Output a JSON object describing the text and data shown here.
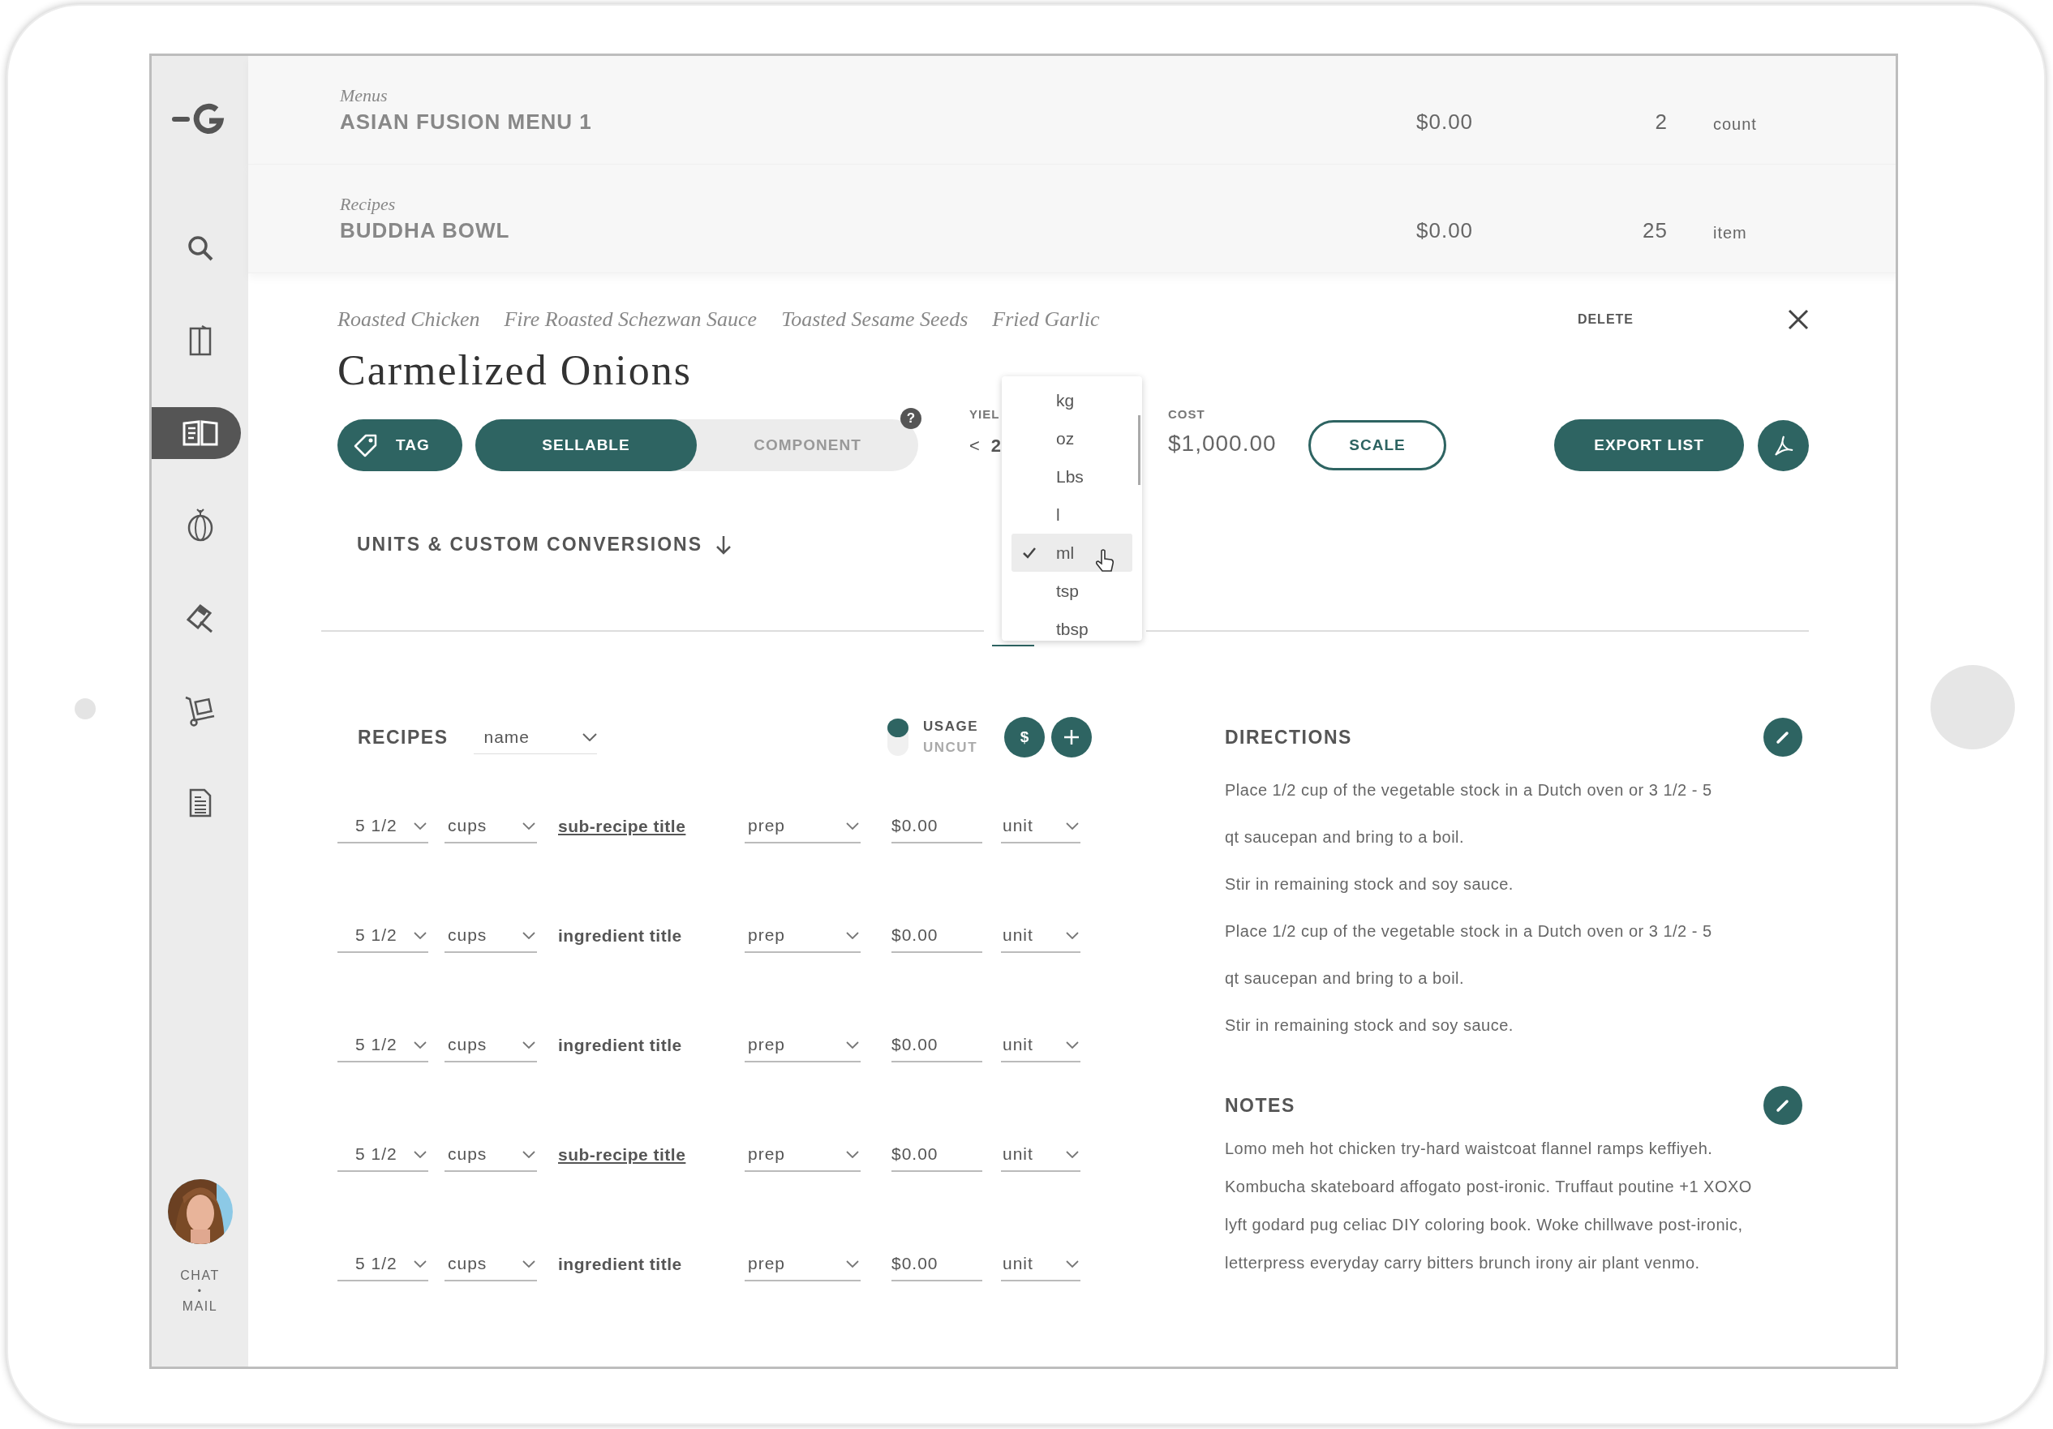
{
  "sidebar": {
    "items": [
      {
        "kind": "search",
        "selected": false
      },
      {
        "kind": "menu",
        "selected": false
      },
      {
        "kind": "recipes",
        "selected": true
      },
      {
        "kind": "produce",
        "selected": false
      },
      {
        "kind": "tag",
        "selected": false
      },
      {
        "kind": "cart",
        "selected": false
      },
      {
        "kind": "report",
        "selected": false
      }
    ],
    "user": {
      "kind": "picture"
    },
    "links": [
      "CHAT",
      "•",
      "MAIL"
    ]
  },
  "header_rows": [
    {
      "category": "Menus",
      "title": "ASIAN FUSION MENU 1",
      "price": "$0.00",
      "quantity": "2",
      "unit": "count"
    },
    {
      "category": "Recipes",
      "title": "BUDDHA BOWL",
      "price": "$0.00",
      "quantity": "25",
      "unit": "item"
    }
  ],
  "breadcrumbs": [
    "Roasted Chicken",
    "Fire Roasted Schezwan Sauce",
    "Toasted Sesame Seeds",
    "Fried Garlic"
  ],
  "delete": "DELETE",
  "title": "Carmelized Onions",
  "tag_button": "TAG",
  "type_toggle": [
    {
      "label": "SELLABLE",
      "selected": true
    },
    {
      "label": "COMPONENT",
      "selected": false
    }
  ],
  "help": "?",
  "yield": {
    "label": "YIEL",
    "prev": "<",
    "value": "2"
  },
  "cost": {
    "label": "COST",
    "value": "$1,000.00"
  },
  "scale_button": "SCALE",
  "export_button": "EXPORT LIST",
  "unit_dropdown": {
    "options": [
      {
        "label": "kg",
        "selected": false
      },
      {
        "label": "oz",
        "selected": false
      },
      {
        "label": "Lbs",
        "selected": false
      },
      {
        "label": "l",
        "selected": false
      },
      {
        "label": "ml",
        "selected": true
      },
      {
        "label": "tsp",
        "selected": false
      },
      {
        "label": "tbsp",
        "selected": false
      }
    ]
  },
  "conversions": "UNITS & CUSTOM CONVERSIONS",
  "recipes": {
    "label": "RECIPES",
    "sort": "name",
    "toggle": [
      {
        "label": "USAGE",
        "selected": true
      },
      {
        "label": "UNCUT",
        "selected": false
      }
    ],
    "cost_button": "$",
    "rows": [
      {
        "quantity": "5 1/2",
        "unit": "cups",
        "title": "sub-recipe title",
        "kind": "sub-recipe",
        "prep": "prep",
        "price": "$0.00",
        "price_unit": "unit"
      },
      {
        "quantity": "5 1/2",
        "unit": "cups",
        "title": "ingredient title",
        "kind": "ingredient",
        "prep": "prep",
        "price": "$0.00",
        "price_unit": "unit"
      },
      {
        "quantity": "5 1/2",
        "unit": "cups",
        "title": "ingredient title",
        "kind": "ingredient",
        "prep": "prep",
        "price": "$0.00",
        "price_unit": "unit"
      },
      {
        "quantity": "5 1/2",
        "unit": "cups",
        "title": "sub-recipe title",
        "kind": "sub-recipe",
        "prep": "prep",
        "price": "$0.00",
        "price_unit": "unit"
      },
      {
        "quantity": "5 1/2",
        "unit": "cups",
        "title": "ingredient title",
        "kind": "ingredient",
        "prep": "prep",
        "price": "$0.00",
        "price_unit": "unit"
      }
    ]
  },
  "directions": {
    "title": "DIRECTIONS",
    "lines": [
      "Place 1/2 cup of the vegetable stock in a Dutch oven or 3 1/2 - 5",
      "qt saucepan and bring to a boil.",
      "Stir in remaining stock and soy sauce.",
      "Place 1/2 cup of the vegetable stock in a Dutch oven or 3 1/2 - 5",
      "qt saucepan and bring to a boil.",
      "Stir in remaining stock and soy sauce."
    ]
  },
  "notes": {
    "title": "NOTES",
    "lines": [
      "Lomo meh hot chicken try-hard waistcoat flannel ramps keffiyeh.",
      "Kombucha skateboard affogato post-ironic. Truffaut poutine +1 XOXO",
      "lyft godard pug celiac DIY coloring book. Woke chillwave post-ironic,",
      "letterpress everyday carry bitters brunch irony air plant venmo."
    ]
  }
}
